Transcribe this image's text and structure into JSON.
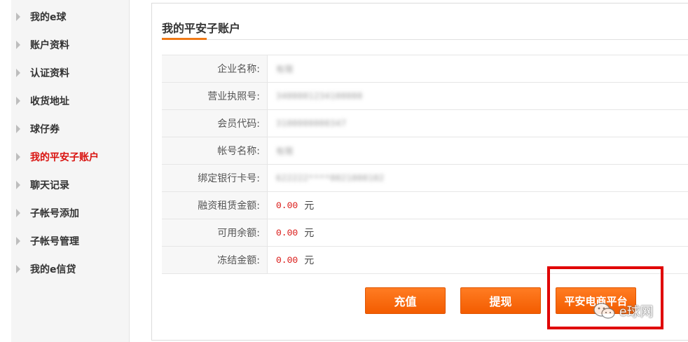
{
  "sidebar": {
    "items": [
      {
        "label": "我的e球",
        "active": false
      },
      {
        "label": "账户资料",
        "active": false
      },
      {
        "label": "认证资料",
        "active": false
      },
      {
        "label": "收货地址",
        "active": false
      },
      {
        "label": "球仔券",
        "active": false
      },
      {
        "label": "我的平安子账户",
        "active": true
      },
      {
        "label": "聊天记录",
        "active": false
      },
      {
        "label": "子帐号添加",
        "active": false
      },
      {
        "label": "子帐号管理",
        "active": false
      },
      {
        "label": "我的e信贷",
        "active": false
      }
    ]
  },
  "main": {
    "title": "我的平安子账户",
    "rows": [
      {
        "label": "企业名称:",
        "value": "有限",
        "blurred": true
      },
      {
        "label": "营业执照号:",
        "value": "3400001234100000",
        "blurred": true
      },
      {
        "label": "会员代码:",
        "value": "3100000000347",
        "blurred": true
      },
      {
        "label": "帐号名称:",
        "value": "有限",
        "blurred": true
      },
      {
        "label": "绑定银行卡号:",
        "value": "622222****0021000102",
        "blurred": true
      },
      {
        "label": "融资租赁金额:",
        "value": "0.00",
        "unit": "元"
      },
      {
        "label": "可用余额:",
        "value": "0.00",
        "unit": "元"
      },
      {
        "label": "冻结金额:",
        "value": "0.00",
        "unit": "元"
      }
    ],
    "buttons": {
      "recharge": "充值",
      "withdraw": "提现",
      "platform": "平安电商平台"
    }
  },
  "watermark": {
    "text": "e球网",
    "icon": "wechat-icon"
  },
  "colors": {
    "accent": "#f35c00",
    "active": "#d9120f",
    "annotation": "#e00000"
  }
}
